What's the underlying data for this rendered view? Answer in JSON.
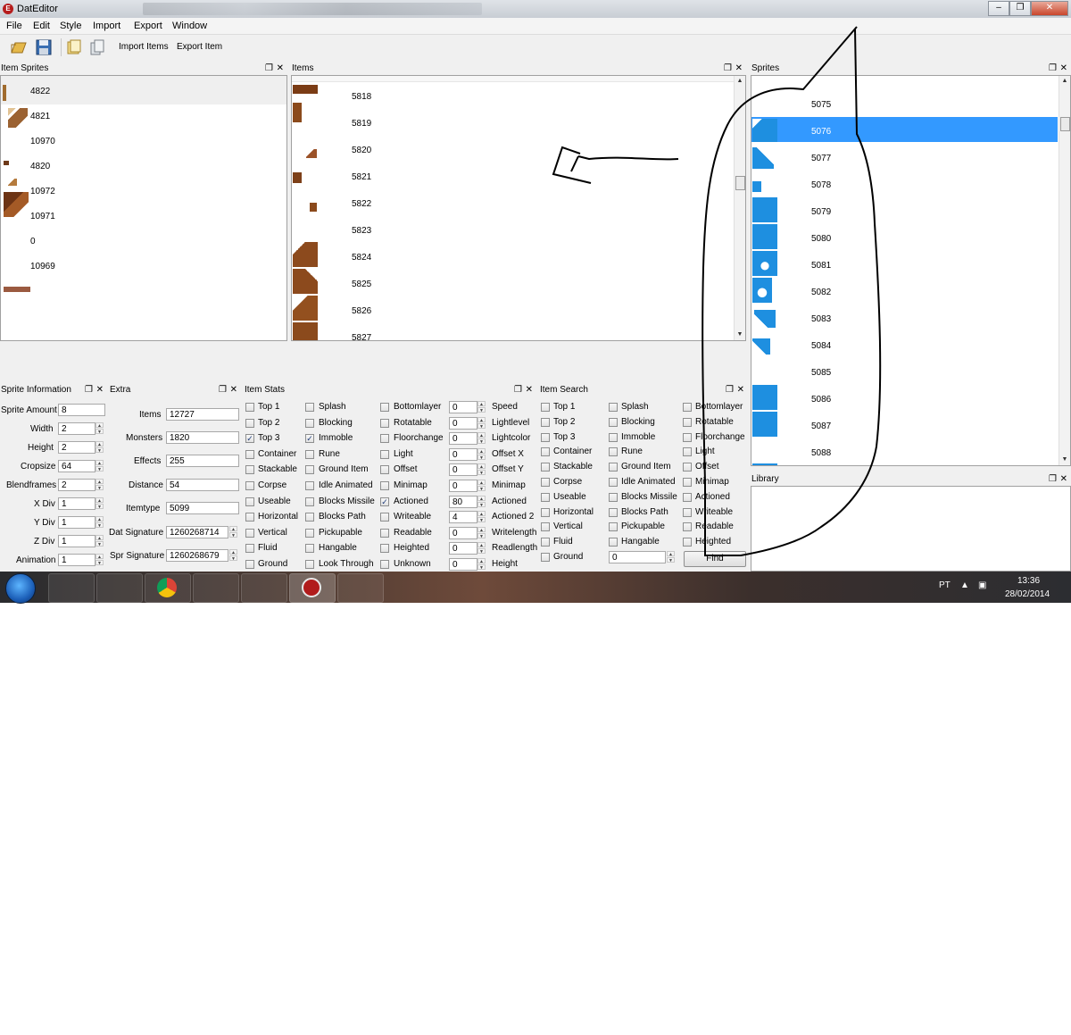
{
  "window": {
    "title": "DatEditor",
    "icon_letter": "E"
  },
  "menu": [
    "File",
    "Edit",
    "Style",
    "Import",
    "Export",
    "Window"
  ],
  "toolbar": {
    "import_items": "Import Items",
    "export_item": "Export Item",
    "icons": [
      "open-folder-icon",
      "save-icon",
      "folder-open-icon",
      "copy-files-icon"
    ]
  },
  "item_sprites": {
    "title": "Item Sprites",
    "rows": [
      "4822",
      "4821",
      "10970",
      "4820",
      "10972",
      "10971",
      "0",
      "10969"
    ]
  },
  "items": {
    "title": "Items",
    "rows": [
      "5818",
      "5819",
      "5820",
      "5821",
      "5822",
      "5823",
      "5824",
      "5825",
      "5826",
      "5827"
    ]
  },
  "sprites": {
    "title": "Sprites",
    "selected": "5076",
    "rows": [
      "5075",
      "5076",
      "5077",
      "5078",
      "5079",
      "5080",
      "5081",
      "5082",
      "5083",
      "5084",
      "5085",
      "5086",
      "5087",
      "5088"
    ]
  },
  "library": {
    "title": "Library"
  },
  "sprite_info": {
    "title": "Sprite Information",
    "fields": [
      {
        "label": "Sprite Amount",
        "value": "8"
      },
      {
        "label": "Width",
        "value": "2"
      },
      {
        "label": "Height",
        "value": "2"
      },
      {
        "label": "Cropsize",
        "value": "64"
      },
      {
        "label": "Blendframes",
        "value": "2"
      },
      {
        "label": "X Div",
        "value": "1"
      },
      {
        "label": "Y Div",
        "value": "1"
      },
      {
        "label": "Z Div",
        "value": "1"
      },
      {
        "label": "Animation",
        "value": "1"
      }
    ]
  },
  "extra": {
    "title": "Extra",
    "fields": [
      {
        "label": "Items",
        "value": "12727"
      },
      {
        "label": "Monsters",
        "value": "1820"
      },
      {
        "label": "Effects",
        "value": "255"
      },
      {
        "label": "Distance",
        "value": "54"
      },
      {
        "label": "Itemtype",
        "value": "5099"
      },
      {
        "label": "Dat Signature",
        "value": "1260268714"
      },
      {
        "label": "Spr Signature",
        "value": "1260268679"
      }
    ]
  },
  "item_stats": {
    "title": "Item Stats",
    "col1": [
      "Top 1",
      "Top 2",
      "Top 3",
      "Container",
      "Stackable",
      "Corpse",
      "Useable",
      "Horizontal",
      "Vertical",
      "Fluid",
      "Ground"
    ],
    "col2": [
      "Splash",
      "Blocking",
      "Immoble",
      "Rune",
      "Ground Item",
      "Idle Animated",
      "Blocks Missile",
      "Blocks Path",
      "Pickupable",
      "Hangable",
      "Look Through"
    ],
    "col3": [
      "Bottomlayer",
      "Rotatable",
      "Floorchange",
      "Light",
      "Offset",
      "Minimap",
      "Actioned",
      "Writeable",
      "Readable",
      "Heighted",
      "Unknown"
    ],
    "checked": [
      "Top 3",
      "Immoble",
      "Actioned"
    ],
    "values": [
      {
        "value": "0",
        "label": "Speed"
      },
      {
        "value": "0",
        "label": "Lightlevel"
      },
      {
        "value": "0",
        "label": "Lightcolor"
      },
      {
        "value": "0",
        "label": "Offset X"
      },
      {
        "value": "0",
        "label": "Offset Y"
      },
      {
        "value": "0",
        "label": "Minimap"
      },
      {
        "value": "80",
        "label": "Actioned"
      },
      {
        "value": "4",
        "label": "Actioned 2"
      },
      {
        "value": "0",
        "label": "Writelength"
      },
      {
        "value": "0",
        "label": "Readlength"
      },
      {
        "value": "0",
        "label": "Height"
      }
    ]
  },
  "item_search": {
    "title": "Item Search",
    "col1": [
      "Top 1",
      "Top 2",
      "Top 3",
      "Container",
      "Stackable",
      "Corpse",
      "Useable",
      "Horizontal",
      "Vertical",
      "Fluid",
      "Ground"
    ],
    "col2": [
      "Splash",
      "Blocking",
      "Immoble",
      "Rune",
      "Ground Item",
      "Idle Animated",
      "Blocks Missile",
      "Blocks Path",
      "Pickupable",
      "Hangable"
    ],
    "col3": [
      "Bottomlayer",
      "Rotatable",
      "Floorchange",
      "Light",
      "Offset",
      "Minimap",
      "Actioned",
      "Writeable",
      "Readable",
      "Heighted"
    ],
    "ground_value": "0",
    "find_label": "Find"
  },
  "taskbar": {
    "language": "PT",
    "time": "13:36",
    "date": "28/02/2014"
  },
  "colors": {
    "selection": "#3399ff",
    "sprite_blue": "#1e8fe0",
    "item_brown": "#8b4a1c",
    "annotation": "#000000"
  }
}
